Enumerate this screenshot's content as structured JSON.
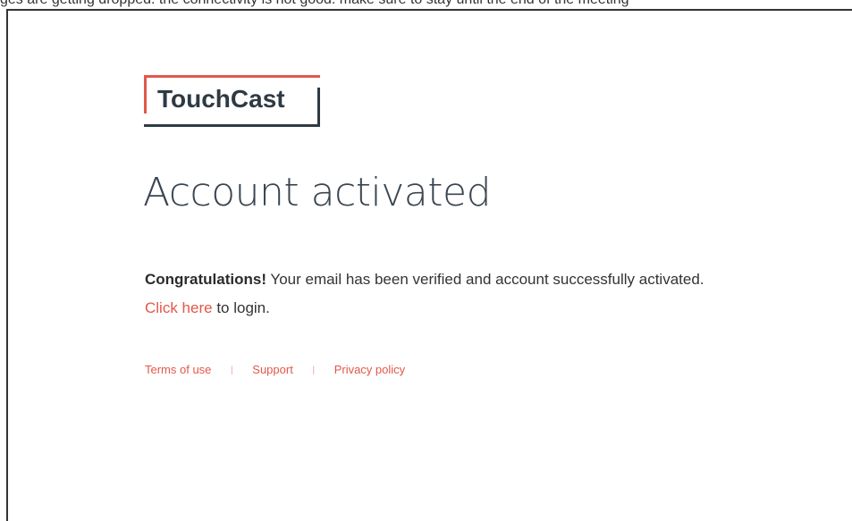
{
  "header_strip": {
    "text": "ges are getting dropped. the connectivity is not good. make sure to stay until the end of the meeting"
  },
  "logo": {
    "text": "TouchCast"
  },
  "page_title": "Account activated",
  "message": {
    "strong": "Congratulations!",
    "body": " Your email has been verified and account successfully activated.",
    "link_label": "Click here",
    "link_suffix": " to login."
  },
  "footer": {
    "links": [
      {
        "label": "Terms of use"
      },
      {
        "label": "Support"
      },
      {
        "label": "Privacy policy"
      }
    ],
    "separator": "|"
  },
  "colors": {
    "accent": "#e2584a",
    "logo_dark": "#2e3a44",
    "text": "#333333"
  }
}
